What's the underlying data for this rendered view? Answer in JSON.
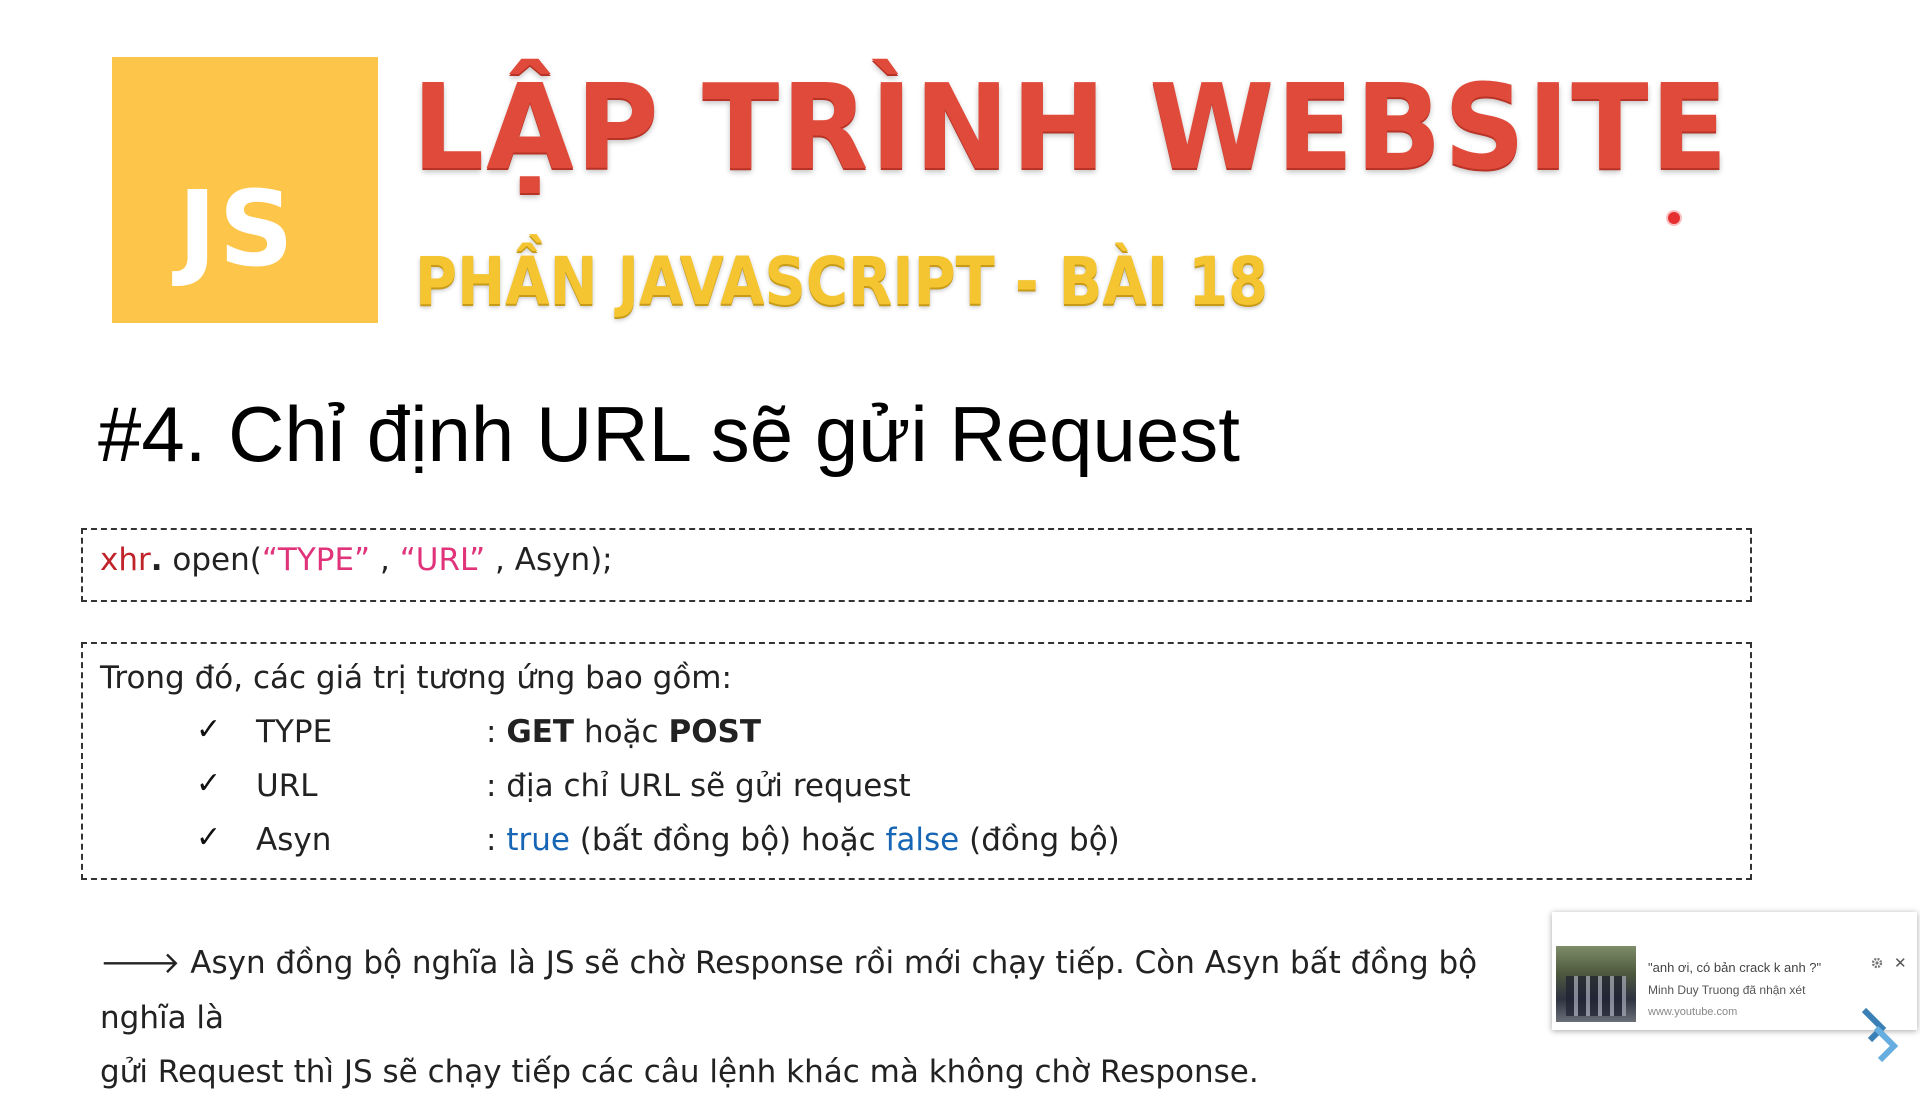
{
  "logo": {
    "text": "JS"
  },
  "header": {
    "title": "LẬP TRÌNH WEBSITE",
    "subtitle": "PHẦN JAVASCRIPT - BÀI 18"
  },
  "section": {
    "heading": "#4. Chỉ định URL sẽ gửi Request"
  },
  "code": {
    "obj": "xhr",
    "dot": ".",
    "fn": " open(",
    "arg1": "“TYPE”",
    "sep1": " , ",
    "arg2": "“URL”",
    "sep2": " , ",
    "arg3": "Asyn);"
  },
  "params": {
    "intro": "Trong đó, các giá trị tương ứng bao gồm:",
    "check_glyph": "✓",
    "items": [
      {
        "name": "TYPE",
        "colon": ": ",
        "v1": "GET",
        "mid": " hoặc ",
        "v2": "POST"
      },
      {
        "name": "URL",
        "desc": ": địa chỉ URL sẽ gửi request"
      },
      {
        "name": "Asyn",
        "colon": ": ",
        "v1": "true",
        "mid": " (bất đồng bộ) hoặc ",
        "v2": "false",
        "tail": " (đồng bộ)"
      }
    ]
  },
  "note": {
    "arrow": "🡒",
    "line1": " Asyn đồng bộ nghĩa là JS sẽ chờ Response rồi mới chạy tiếp. Còn Asyn bất đồng bộ nghĩa là",
    "line2": "gửi Request thì JS sẽ chạy tiếp các câu lệnh khác mà không chờ Response."
  },
  "notification": {
    "comment": "\"anh ơi, có bản crack k anh ?\"",
    "user": "Minh Duy Truong đã nhận xét",
    "site": "www.youtube.com",
    "gear_icon": "gear-icon",
    "close_glyph": "✕"
  },
  "colors": {
    "title_red": "#e04a3a",
    "subtitle_yellow": "#f4c531",
    "logo_yellow": "#fdc54a",
    "code_red": "#c0242a",
    "code_pink": "#e0337a",
    "keyword_blue": "#1766b5"
  }
}
